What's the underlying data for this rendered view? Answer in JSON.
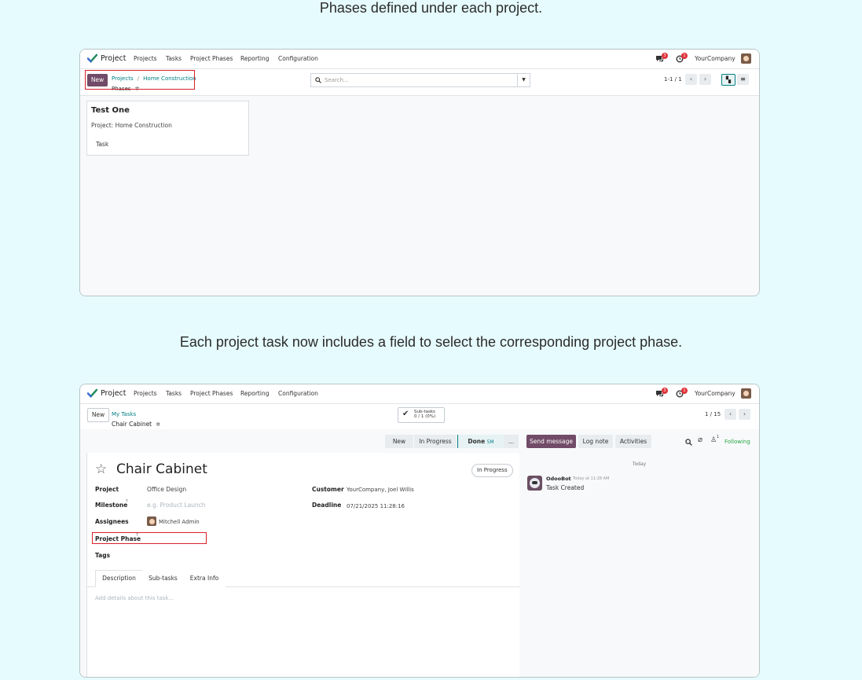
{
  "captions": {
    "first": "Phases defined under each project.",
    "second": "Each project task now includes a field to select the corresponding project phase."
  },
  "colors": {
    "accent": "#714b67",
    "teal": "#017e84",
    "highlight": "#d9202a",
    "badge": "#e0323a",
    "following": "#28a745"
  },
  "nav": {
    "app_name": "Project",
    "menu": [
      "Projects",
      "Tasks",
      "Project Phases",
      "Reporting",
      "Configuration"
    ],
    "chat_badge": "3",
    "activity_badge": "1",
    "company": "YourCompany"
  },
  "screen1": {
    "new_label": "New",
    "breadcrumb_root": "Projects",
    "breadcrumb_sep": "/",
    "breadcrumb_project": "Home Construction",
    "breadcrumb_current": "Phases",
    "search_placeholder": "Search...",
    "pager": "1-1 / 1",
    "card": {
      "title": "Test One",
      "project": "Project: Home Construction",
      "task": "Task"
    }
  },
  "screen2": {
    "new_label": "New",
    "breadcrumb_parent": "My Tasks",
    "breadcrumb_current": "Chair Cabinet",
    "subtasks_label": "Sub-tasks",
    "subtasks_count": "0 / 1 (0%)",
    "pager": "1 / 15",
    "stages": {
      "new": "New",
      "in_progress": "In Progress",
      "done": "Done",
      "done_time": "5M",
      "more": "..."
    },
    "task_title": "Chair Cabinet",
    "state_badge": "In Progress",
    "fields": {
      "project_label": "Project",
      "project_value": "Office Design",
      "milestone_label": "Milestone",
      "milestone_placeholder": "e.g. Product Launch",
      "assignees_label": "Assignees",
      "assignees_value": "Mitchell Admin",
      "project_phase_label": "Project Phase",
      "tags_label": "Tags",
      "customer_label": "Customer",
      "customer_value": "YourCompany, Joel Willis",
      "deadline_label": "Deadline",
      "deadline_value": "07/21/2025 11:28:16",
      "help_mark": "?"
    },
    "tabs": [
      "Description",
      "Sub-tasks",
      "Extra Info"
    ],
    "description_placeholder": "Add details about this task...",
    "chatter": {
      "send_message": "Send message",
      "log_note": "Log note",
      "activities": "Activities",
      "followers_count": "1",
      "following": "Following",
      "day_separator": "Today",
      "author": "OdooBot",
      "time": "Today at 11:28 AM",
      "message": "Task Created"
    }
  }
}
